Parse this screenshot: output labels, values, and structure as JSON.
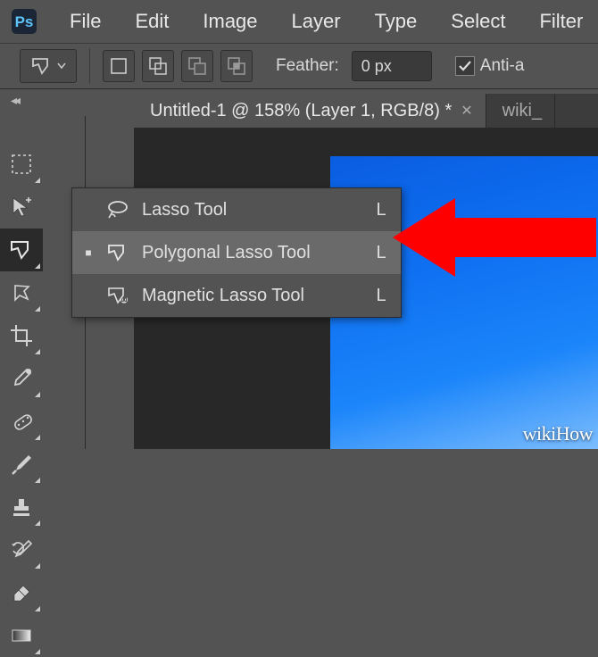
{
  "menu": {
    "file": "File",
    "edit": "Edit",
    "image": "Image",
    "layer": "Layer",
    "type": "Type",
    "select": "Select",
    "filter": "Filter"
  },
  "options": {
    "feather_label": "Feather:",
    "feather_value": "0 px",
    "antialias_label": "Anti-a"
  },
  "tabs": {
    "active": "Untitled-1 @ 158% (Layer 1, RGB/8) *",
    "inactive": "wiki_"
  },
  "flyout": {
    "items": [
      {
        "label": "Lasso Tool",
        "shortcut": "L",
        "selected": false
      },
      {
        "label": "Polygonal Lasso Tool",
        "shortcut": "L",
        "selected": true
      },
      {
        "label": "Magnetic Lasso Tool",
        "shortcut": "L",
        "selected": false
      }
    ]
  },
  "watermark": "wikiHow"
}
